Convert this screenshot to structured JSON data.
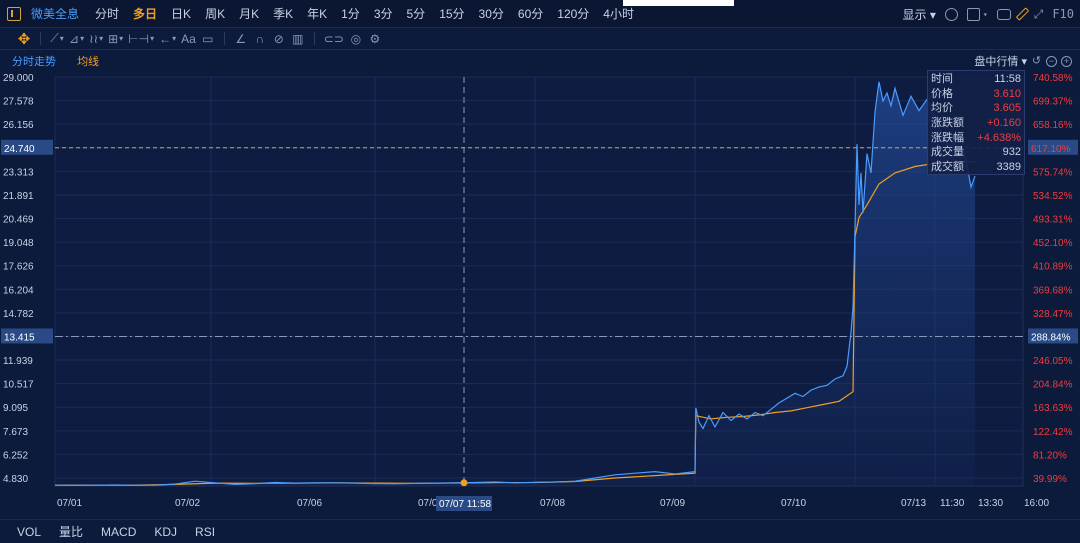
{
  "header": {
    "stock_name": "微美全息",
    "tabs": [
      "分时",
      "多日",
      "日K",
      "周K",
      "月K",
      "季K",
      "年K",
      "1分",
      "3分",
      "5分",
      "15分",
      "30分",
      "60分",
      "120分",
      "4小时"
    ],
    "active_tab": "多日",
    "display_label": "显示",
    "f10_label": "F10"
  },
  "toolbar": {
    "text_tool_label": "Aa"
  },
  "chart_header": {
    "left_label": "分时走势",
    "avg_label": "均线",
    "right_label": "盘中行情"
  },
  "tooltip": {
    "rows": [
      {
        "k": "时间",
        "v": "11:58",
        "up": false
      },
      {
        "k": "价格",
        "v": "3.610",
        "up": true
      },
      {
        "k": "均价",
        "v": "3.605",
        "up": true
      },
      {
        "k": "涨跌额",
        "v": "+0.160",
        "up": true
      },
      {
        "k": "涨跌幅",
        "v": "+4.638%",
        "up": true
      },
      {
        "k": "成交量",
        "v": "932",
        "up": false
      },
      {
        "k": "成交额",
        "v": "3389",
        "up": false
      }
    ]
  },
  "crosshair": {
    "time_label": "07/07 11:58",
    "horizontal_price": "24.740",
    "horizontal_pct": "617.10%",
    "ref_price": "13.415",
    "ref_pct": "288.84%"
  },
  "bottom_tabs": [
    "VOL",
    "量比",
    "MACD",
    "KDJ",
    "RSI"
  ],
  "colors": {
    "price_line": "#4a9cff",
    "avg_line": "#f0a020",
    "up": "#f23d3d",
    "background": "#0c1a3c"
  },
  "chart_data": {
    "type": "line",
    "y_ticks": [
      "29.000",
      "27.578",
      "26.156",
      "24.740",
      "23.313",
      "21.891",
      "20.469",
      "19.048",
      "17.626",
      "16.204",
      "14.782",
      "13.415",
      "11.939",
      "10.517",
      "9.095",
      "7.673",
      "6.252",
      "4.830"
    ],
    "y_pct_ticks": [
      "740.58%",
      "699.37%",
      "658.16%",
      "617.10%",
      "575.74%",
      "534.52%",
      "493.31%",
      "452.10%",
      "410.89%",
      "369.68%",
      "328.47%",
      "288.84%",
      "246.05%",
      "204.84%",
      "163.63%",
      "122.42%",
      "81.20%",
      "39.99%"
    ],
    "x_labels": [
      "07/01",
      "07/02",
      "07/06",
      "07/07",
      "07/08",
      "07/09",
      "07/10",
      "07/13",
      "11:30",
      "13:30",
      "16:00"
    ],
    "ylim": [
      3.4,
      29.0
    ],
    "series": [
      {
        "name": "价格",
        "points": [
          [
            0,
            3.45
          ],
          [
            0.5,
            3.44
          ],
          [
            1,
            3.45
          ],
          [
            1.5,
            3.46
          ],
          [
            2,
            3.44
          ],
          [
            2.5,
            3.45
          ],
          [
            3,
            3.52
          ],
          [
            3.5,
            3.7
          ],
          [
            4,
            3.6
          ],
          [
            4.5,
            3.5
          ],
          [
            5,
            3.55
          ],
          [
            5.5,
            3.62
          ],
          [
            6,
            3.58
          ],
          [
            6.5,
            3.6
          ],
          [
            7,
            3.6
          ],
          [
            7.5,
            3.58
          ],
          [
            8,
            3.55
          ],
          [
            8.5,
            3.54
          ],
          [
            9,
            3.56
          ],
          [
            9.5,
            3.58
          ],
          [
            10,
            3.6
          ],
          [
            10.5,
            3.62
          ],
          [
            11,
            3.65
          ],
          [
            11.5,
            3.6
          ],
          [
            12,
            3.63
          ],
          [
            12.5,
            3.65
          ],
          [
            13,
            3.7
          ],
          [
            13.5,
            3.9
          ],
          [
            14,
            4.1
          ],
          [
            14.5,
            4.2
          ],
          [
            15,
            4.3
          ],
          [
            15.5,
            4.15
          ],
          [
            16,
            4.3
          ],
          [
            16.02,
            8.3
          ],
          [
            16.1,
            7.4
          ],
          [
            16.2,
            7.0
          ],
          [
            16.35,
            7.8
          ],
          [
            16.5,
            7.1
          ],
          [
            16.7,
            8.0
          ],
          [
            16.9,
            7.5
          ],
          [
            17.1,
            7.9
          ],
          [
            17.3,
            7.6
          ],
          [
            17.5,
            8.0
          ],
          [
            17.7,
            7.8
          ],
          [
            17.9,
            8.2
          ],
          [
            18.1,
            8.6
          ],
          [
            18.3,
            8.9
          ],
          [
            18.5,
            9.2
          ],
          [
            18.7,
            9.0
          ],
          [
            18.9,
            9.4
          ],
          [
            19.1,
            9.6
          ],
          [
            19.3,
            9.7
          ],
          [
            19.5,
            10.1
          ],
          [
            19.7,
            10.3
          ],
          [
            19.8,
            10.9
          ],
          [
            19.9,
            13.0
          ],
          [
            19.95,
            14.6
          ],
          [
            20.0,
            19.5
          ],
          [
            20.05,
            24.8
          ],
          [
            20.1,
            21.0
          ],
          [
            20.15,
            23.0
          ],
          [
            20.2,
            20.5
          ],
          [
            20.3,
            24.2
          ],
          [
            20.4,
            23.0
          ],
          [
            20.5,
            26.8
          ],
          [
            20.6,
            28.7
          ],
          [
            20.7,
            27.5
          ],
          [
            20.8,
            28.0
          ],
          [
            20.9,
            27.2
          ],
          [
            21.0,
            28.3
          ],
          [
            21.2,
            26.6
          ],
          [
            21.4,
            27.8
          ],
          [
            21.6,
            26.9
          ],
          [
            21.8,
            27.6
          ],
          [
            22.0,
            26.5
          ],
          [
            22.2,
            25.2
          ],
          [
            22.4,
            24.6
          ],
          [
            22.6,
            25.6
          ],
          [
            22.8,
            23.5
          ],
          [
            22.9,
            22.1
          ],
          [
            23.0,
            22.8
          ]
        ]
      },
      {
        "name": "均价",
        "points": [
          [
            0,
            3.45
          ],
          [
            1,
            3.45
          ],
          [
            2,
            3.45
          ],
          [
            3,
            3.5
          ],
          [
            4,
            3.58
          ],
          [
            5,
            3.57
          ],
          [
            6,
            3.58
          ],
          [
            7,
            3.6
          ],
          [
            8,
            3.58
          ],
          [
            9,
            3.57
          ],
          [
            10,
            3.59
          ],
          [
            11,
            3.61
          ],
          [
            12,
            3.62
          ],
          [
            13,
            3.68
          ],
          [
            14,
            3.9
          ],
          [
            15,
            4.05
          ],
          [
            16,
            4.2
          ],
          [
            16.02,
            7.8
          ],
          [
            16.4,
            7.6
          ],
          [
            16.8,
            7.7
          ],
          [
            17.2,
            7.75
          ],
          [
            17.6,
            7.85
          ],
          [
            18.0,
            8.0
          ],
          [
            18.4,
            8.1
          ],
          [
            18.8,
            8.3
          ],
          [
            19.2,
            8.5
          ],
          [
            19.6,
            8.7
          ],
          [
            19.95,
            9.3
          ],
          [
            20.0,
            19.0
          ],
          [
            20.1,
            20.2
          ],
          [
            20.3,
            21.0
          ],
          [
            20.6,
            22.3
          ],
          [
            21.0,
            23.0
          ],
          [
            21.5,
            23.4
          ],
          [
            22.0,
            23.6
          ],
          [
            22.5,
            23.7
          ],
          [
            23.0,
            23.7
          ]
        ]
      }
    ]
  }
}
